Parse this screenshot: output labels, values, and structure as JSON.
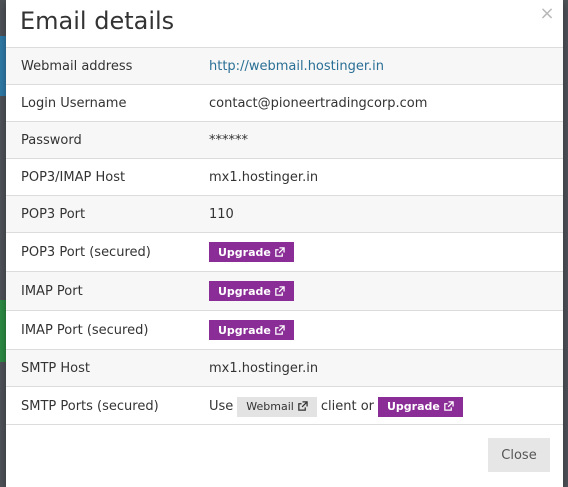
{
  "dialog": {
    "title": "Email details",
    "close_glyph": "×",
    "close_button": "Close"
  },
  "rows": [
    {
      "label": "Webmail address",
      "value": "http://webmail.hostinger.in"
    },
    {
      "label": "Login Username",
      "value": "contact@pioneertradingcorp.com"
    },
    {
      "label": "Password",
      "value": "******"
    },
    {
      "label": "POP3/IMAP Host",
      "value": "mx1.hostinger.in"
    },
    {
      "label": "POP3 Port",
      "value": "110"
    },
    {
      "label": "POP3 Port (secured)",
      "button": "Upgrade"
    },
    {
      "label": "IMAP Port",
      "button": "Upgrade"
    },
    {
      "label": "IMAP Port (secured)",
      "button": "Upgrade"
    },
    {
      "label": "SMTP Host",
      "value": "mx1.hostinger.in"
    },
    {
      "label": "SMTP Ports (secured)",
      "prefix": "Use",
      "webmail_button": "Webmail",
      "middle": "client or",
      "button": "Upgrade"
    }
  ],
  "icons": {
    "external_link": "external-link-icon",
    "close": "close-icon"
  },
  "colors": {
    "upgrade_bg": "#8a2d96",
    "link": "#2a6f95",
    "row_alt": "#f7f7f7"
  }
}
